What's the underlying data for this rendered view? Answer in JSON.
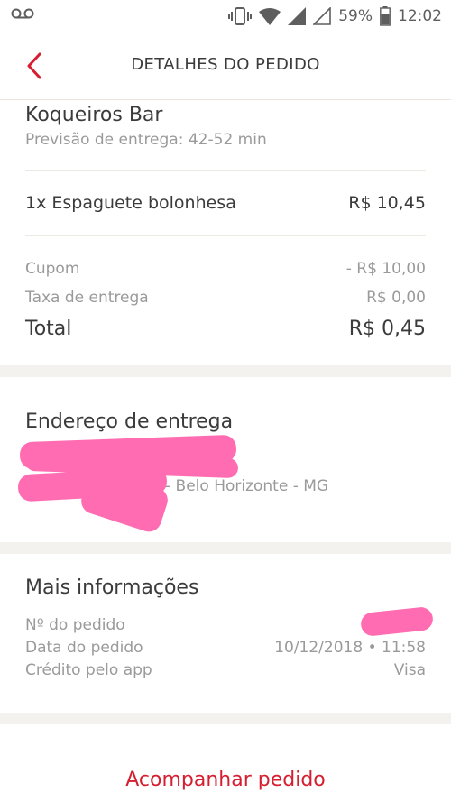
{
  "status_bar": {
    "battery": "59%",
    "time": "12:02",
    "icons": [
      "voicemail-icon",
      "vibrate-icon",
      "wifi-icon",
      "signal-icon",
      "signal-empty-icon",
      "battery-icon"
    ]
  },
  "header": {
    "title": "DETALHES DO PEDIDO",
    "back_icon": "chevron-left-icon",
    "accent_color": "#d51f31"
  },
  "restaurant": {
    "name": "Koqueiros Bar",
    "delivery_estimate": "Previsão de entrega: 42-52 min"
  },
  "items": [
    {
      "label": "1x Espaguete bolonhesa",
      "price": "R$ 10,45"
    }
  ],
  "summary": {
    "coupon_label": "Cupom",
    "coupon_value": "- R$ 10,00",
    "fee_label": "Taxa de entrega",
    "fee_value": "R$ 0,00",
    "total_label": "Total",
    "total_value": "R$ 0,45"
  },
  "address": {
    "title": "Endereço de entrega",
    "city_line": "- Belo Horizonte - MG"
  },
  "info": {
    "title": "Mais informações",
    "order_number_label": "Nº do pedido",
    "order_number_value": "",
    "order_date_label": "Data do pedido",
    "order_date_value": "10/12/2018 • 11:58",
    "payment_label": "Crédito pelo app",
    "payment_value": "Visa"
  },
  "footer": {
    "track_label": "Acompanhar pedido"
  }
}
